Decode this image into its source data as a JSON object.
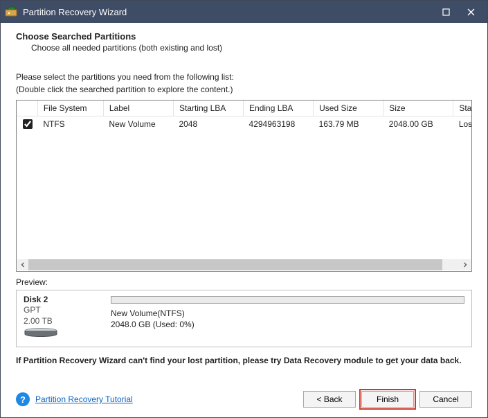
{
  "titlebar": {
    "title": "Partition Recovery Wizard"
  },
  "heading": "Choose Searched Partitions",
  "subheading": "Choose all needed partitions (both existing and lost)",
  "instructions_line1": "Please select the partitions you need from the following list:",
  "instructions_line2": "(Double click the searched partition to explore the content.)",
  "table": {
    "columns": [
      "",
      "File System",
      "Label",
      "Starting LBA",
      "Ending LBA",
      "Used Size",
      "Size",
      "Status"
    ],
    "column_display": [
      "",
      "File System",
      "Label",
      "Starting LBA",
      "Ending LBA",
      "Used Size",
      "Size",
      "Statu"
    ],
    "rows": [
      {
        "checked": true,
        "filesystem": "NTFS",
        "label": "New Volume",
        "start_lba": "2048",
        "end_lba": "4294963198",
        "used_size": "163.79 MB",
        "size": "2048.00 GB",
        "status": "Lost/"
      }
    ]
  },
  "preview_label": "Preview:",
  "preview": {
    "disk_name": "Disk 2",
    "disk_type": "GPT",
    "disk_size": "2.00 TB",
    "vol_line1": "New Volume(NTFS)",
    "vol_line2": "2048.0 GB (Used: 0%)"
  },
  "note": "If Partition Recovery Wizard can't find your lost partition, please try Data Recovery module to get your data back.",
  "footer": {
    "tutorial": "Partition Recovery Tutorial",
    "back": "<  Back",
    "finish": "Finish",
    "cancel": "Cancel"
  }
}
